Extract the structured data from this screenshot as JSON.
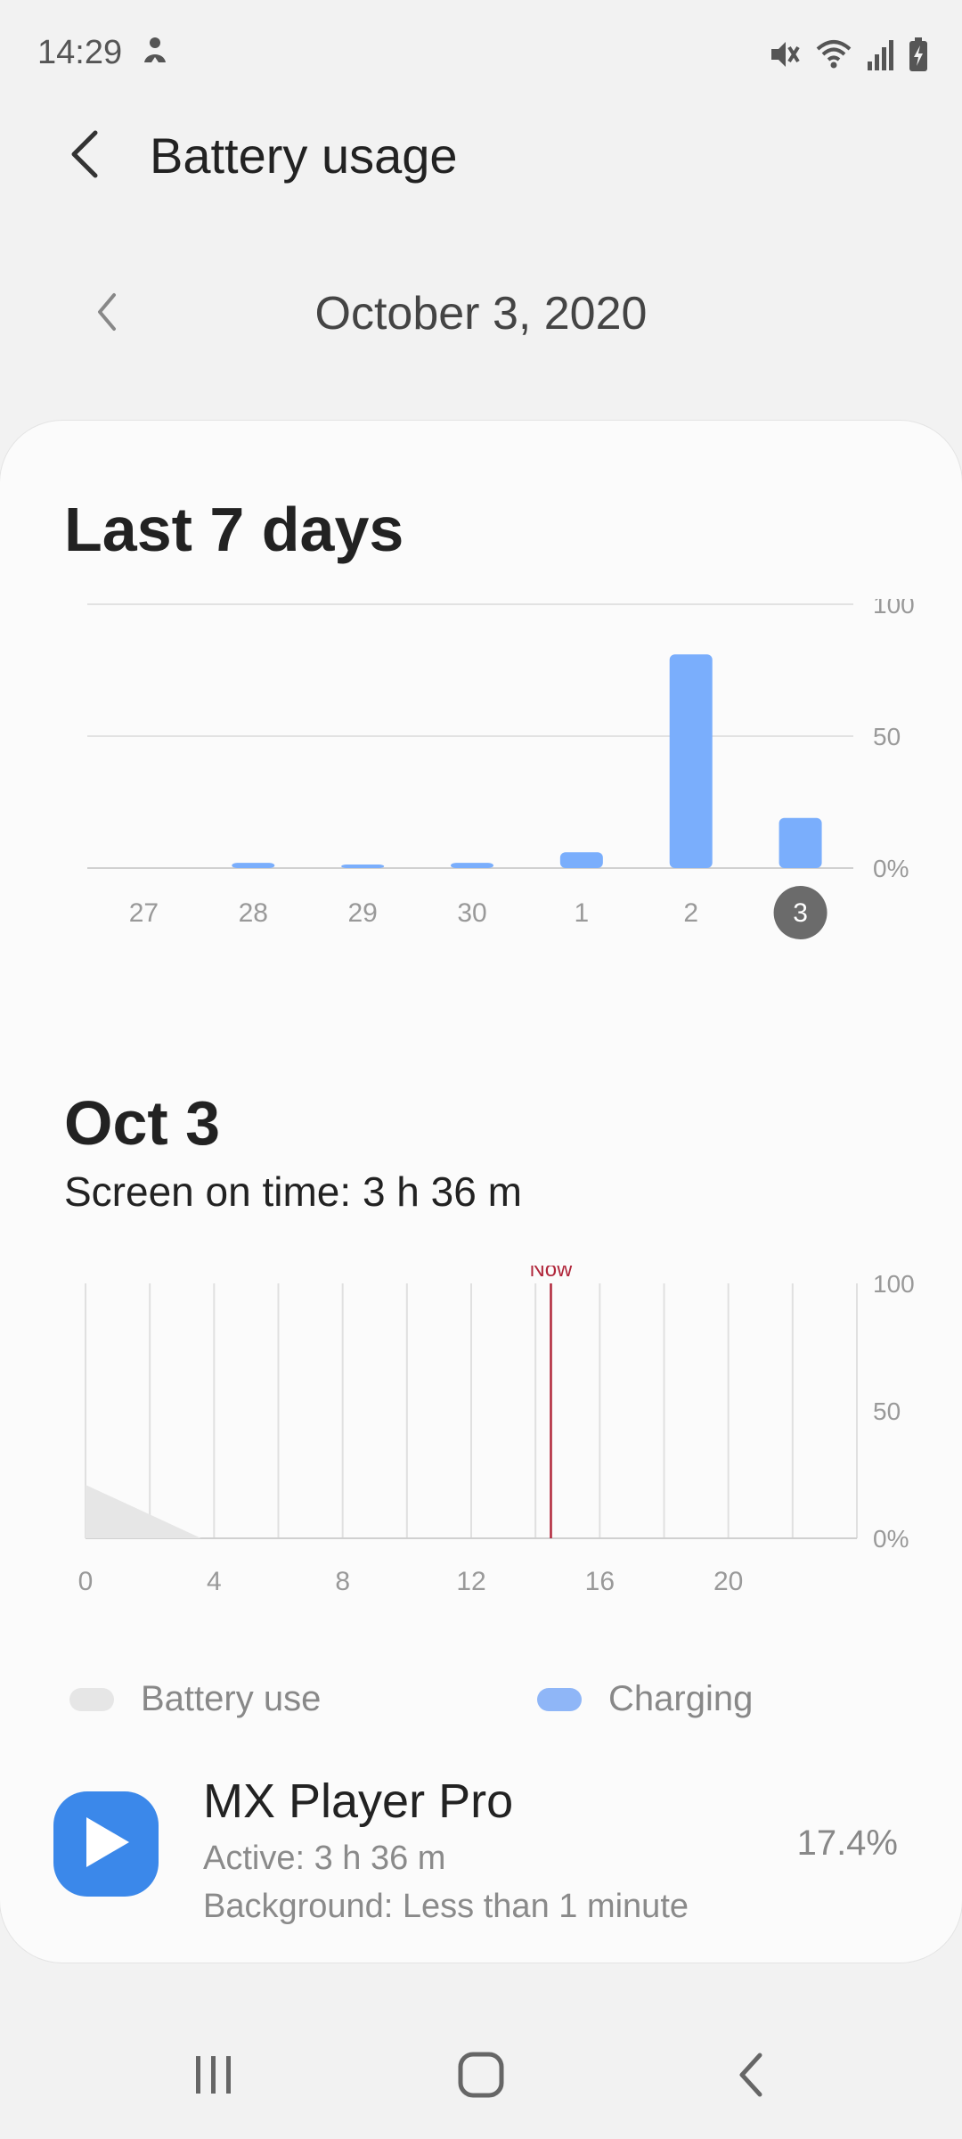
{
  "status_bar": {
    "time": "14:29",
    "left_icon": "accessibility-figure-icon",
    "right_icons": [
      "mute-icon",
      "wifi-icon",
      "signal-icon",
      "battery-charging-icon"
    ]
  },
  "header": {
    "title": "Battery usage",
    "back_icon": "chevron-left-icon"
  },
  "date_nav": {
    "date": "October 3, 2020",
    "prev_icon": "chevron-left-icon"
  },
  "weekly": {
    "title": "Last 7 days",
    "chart_data": {
      "type": "bar",
      "categories": [
        "27",
        "28",
        "29",
        "30",
        "1",
        "2",
        "3"
      ],
      "values": [
        0,
        2,
        1,
        2,
        6,
        81,
        19
      ],
      "ylim": [
        0,
        100
      ],
      "y_ticks": [
        "100",
        "50",
        "0%"
      ],
      "selected_category": "3",
      "bar_color": "#7aaefc",
      "grid": true
    }
  },
  "daily": {
    "title": "Oct 3",
    "screen_on_time": "Screen on time: 3 h 36 m",
    "now_label": "Now",
    "chart_data": {
      "type": "area",
      "x_ticks": [
        "0",
        "4",
        "8",
        "12",
        "16",
        "20"
      ],
      "x_range": [
        0,
        24
      ],
      "y_ticks": [
        "100",
        "50",
        "0%"
      ],
      "ylim": [
        0,
        100
      ],
      "battery_use": {
        "x": [
          0,
          3.6
        ],
        "y": [
          21,
          0
        ]
      },
      "now_hour": 14.48,
      "grid": true,
      "now_color": "#b0263a"
    }
  },
  "legend": {
    "items": [
      {
        "label": "Battery use",
        "color": "#e6e6e6"
      },
      {
        "label": "Charging",
        "color": "#8fb6f7"
      }
    ]
  },
  "app": {
    "name": "MX Player Pro",
    "active": "Active: 3 h 36 m",
    "background": "Background: Less than 1 minute",
    "percent": "17.4%",
    "icon": "play-icon",
    "icon_color": "#3b88ea"
  },
  "nav": {
    "items": [
      "recent-apps-icon",
      "home-icon",
      "back-icon"
    ]
  }
}
